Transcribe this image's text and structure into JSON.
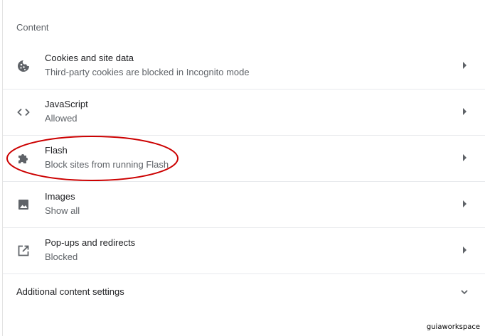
{
  "section": {
    "title": "Content"
  },
  "rows": [
    {
      "title": "Cookies and site data",
      "subtitle": "Third-party cookies are blocked in Incognito mode",
      "icon": "cookie-icon"
    },
    {
      "title": "JavaScript",
      "subtitle": "Allowed",
      "icon": "code-icon"
    },
    {
      "title": "Flash",
      "subtitle": "Block sites from running Flash",
      "icon": "puzzle-icon"
    },
    {
      "title": "Images",
      "subtitle": "Show all",
      "icon": "image-icon"
    },
    {
      "title": "Pop-ups and redirects",
      "subtitle": "Blocked",
      "icon": "open-in-new-icon"
    }
  ],
  "additional": {
    "label": "Additional content settings",
    "icon": "chevron-down-icon"
  },
  "annotation": {
    "color": "#cc0000"
  },
  "watermark": {
    "text": "guiaworkspace"
  }
}
